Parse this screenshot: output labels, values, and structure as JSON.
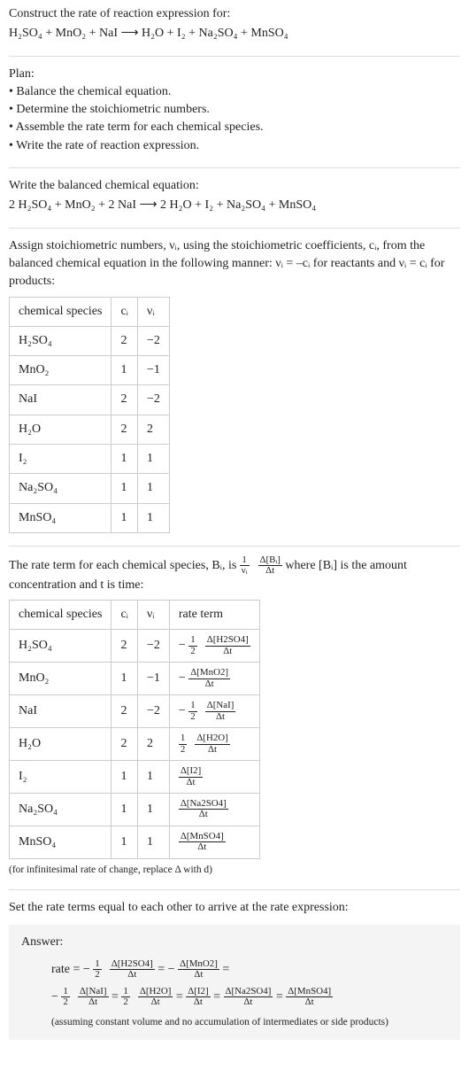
{
  "intro": {
    "construct_line": "Construct the rate of reaction expression for:",
    "reaction_unbalanced": "H₂SO₄ + MnO₂ + NaI ⟶ H₂O + I₂ + Na₂SO₄ + MnSO₄"
  },
  "plan": {
    "heading": "Plan:",
    "items": [
      "Balance the chemical equation.",
      "Determine the stoichiometric numbers.",
      "Assemble the rate term for each chemical species.",
      "Write the rate of reaction expression."
    ]
  },
  "balanced": {
    "heading": "Write the balanced chemical equation:",
    "equation": "2 H₂SO₄ + MnO₂ + 2 NaI ⟶ 2 H₂O + I₂ + Na₂SO₄ + MnSO₄"
  },
  "assign": {
    "text": "Assign stoichiometric numbers, νᵢ, using the stoichiometric coefficients, cᵢ, from the balanced chemical equation in the following manner: νᵢ = –cᵢ for reactants and νᵢ = cᵢ for products:",
    "headers": {
      "species": "chemical species",
      "ci": "cᵢ",
      "vi": "νᵢ"
    },
    "rows": [
      {
        "species": "H₂SO₄",
        "ci": "2",
        "vi": "−2"
      },
      {
        "species": "MnO₂",
        "ci": "1",
        "vi": "−1"
      },
      {
        "species": "NaI",
        "ci": "2",
        "vi": "−2"
      },
      {
        "species": "H₂O",
        "ci": "2",
        "vi": "2"
      },
      {
        "species": "I₂",
        "ci": "1",
        "vi": "1"
      },
      {
        "species": "Na₂SO₄",
        "ci": "1",
        "vi": "1"
      },
      {
        "species": "MnSO₄",
        "ci": "1",
        "vi": "1"
      }
    ]
  },
  "rateterm_intro": {
    "part1": "The rate term for each chemical species, Bᵢ, is ",
    "inv_vi_num": "1",
    "inv_vi_den": "νᵢ",
    "mid_num": "Δ[Bᵢ]",
    "mid_den": "Δt",
    "part2": " where [Bᵢ] is the amount concentration and t is time:"
  },
  "ratetable": {
    "headers": {
      "species": "chemical species",
      "ci": "cᵢ",
      "vi": "νᵢ",
      "rate": "rate term"
    },
    "rows": [
      {
        "species": "H₂SO₄",
        "ci": "2",
        "vi": "−2",
        "sign": "−",
        "coef_num": "1",
        "coef_den": "2",
        "conc": "Δ[H2SO4]",
        "dt": "Δt"
      },
      {
        "species": "MnO₂",
        "ci": "1",
        "vi": "−1",
        "sign": "−",
        "coef_num": "",
        "coef_den": "",
        "conc": "Δ[MnO2]",
        "dt": "Δt"
      },
      {
        "species": "NaI",
        "ci": "2",
        "vi": "−2",
        "sign": "−",
        "coef_num": "1",
        "coef_den": "2",
        "conc": "Δ[NaI]",
        "dt": "Δt"
      },
      {
        "species": "H₂O",
        "ci": "2",
        "vi": "2",
        "sign": "",
        "coef_num": "1",
        "coef_den": "2",
        "conc": "Δ[H2O]",
        "dt": "Δt"
      },
      {
        "species": "I₂",
        "ci": "1",
        "vi": "1",
        "sign": "",
        "coef_num": "",
        "coef_den": "",
        "conc": "Δ[I2]",
        "dt": "Δt"
      },
      {
        "species": "Na₂SO₄",
        "ci": "1",
        "vi": "1",
        "sign": "",
        "coef_num": "",
        "coef_den": "",
        "conc": "Δ[Na2SO4]",
        "dt": "Δt"
      },
      {
        "species": "MnSO₄",
        "ci": "1",
        "vi": "1",
        "sign": "",
        "coef_num": "",
        "coef_den": "",
        "conc": "Δ[MnSO4]",
        "dt": "Δt"
      }
    ],
    "note": "(for infinitesimal rate of change, replace Δ with d)"
  },
  "setequal": "Set the rate terms equal to each other to arrive at the rate expression:",
  "answer": {
    "title": "Answer:",
    "terms": {
      "rate_label": "rate = ",
      "t1": {
        "sign": "−",
        "cn": "1",
        "cd": "2",
        "num": "Δ[H2SO4]",
        "den": "Δt"
      },
      "t2": {
        "sign": "−",
        "cn": "",
        "cd": "",
        "num": "Δ[MnO2]",
        "den": "Δt"
      },
      "t3": {
        "sign": "−",
        "cn": "1",
        "cd": "2",
        "num": "Δ[NaI]",
        "den": "Δt"
      },
      "t4": {
        "sign": "",
        "cn": "1",
        "cd": "2",
        "num": "Δ[H2O]",
        "den": "Δt"
      },
      "t5": {
        "sign": "",
        "cn": "",
        "cd": "",
        "num": "Δ[I2]",
        "den": "Δt"
      },
      "t6": {
        "sign": "",
        "cn": "",
        "cd": "",
        "num": "Δ[Na2SO4]",
        "den": "Δt"
      },
      "t7": {
        "sign": "",
        "cn": "",
        "cd": "",
        "num": "Δ[MnSO4]",
        "den": "Δt"
      },
      "eq": " = "
    },
    "note": "(assuming constant volume and no accumulation of intermediates or side products)"
  }
}
